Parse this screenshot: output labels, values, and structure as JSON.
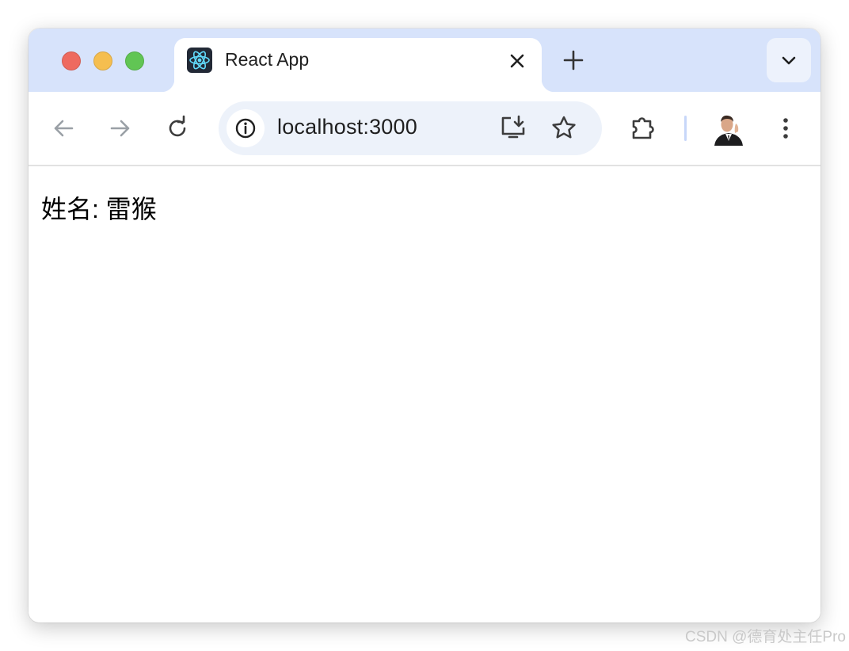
{
  "browser": {
    "tab": {
      "title": "React App",
      "favicon": "react-logo-icon"
    },
    "address_bar": {
      "url": "localhost:3000"
    },
    "icons": {
      "back": "arrow-left-icon",
      "forward": "arrow-right-icon",
      "reload": "reload-icon",
      "site_info": "info-icon",
      "install": "install-app-icon",
      "bookmark": "star-icon",
      "extensions": "puzzle-icon",
      "menu": "more-vert-icon",
      "new_tab": "plus-icon",
      "tab_search": "chevron-down-icon",
      "close_tab": "close-icon"
    },
    "colors": {
      "tabstrip": "#d7e3fb",
      "omnibox": "#edf2fa",
      "accent": "#61dafb"
    }
  },
  "page": {
    "text": "姓名: 雷猴"
  },
  "watermark": "CSDN @德育处主任Pro"
}
